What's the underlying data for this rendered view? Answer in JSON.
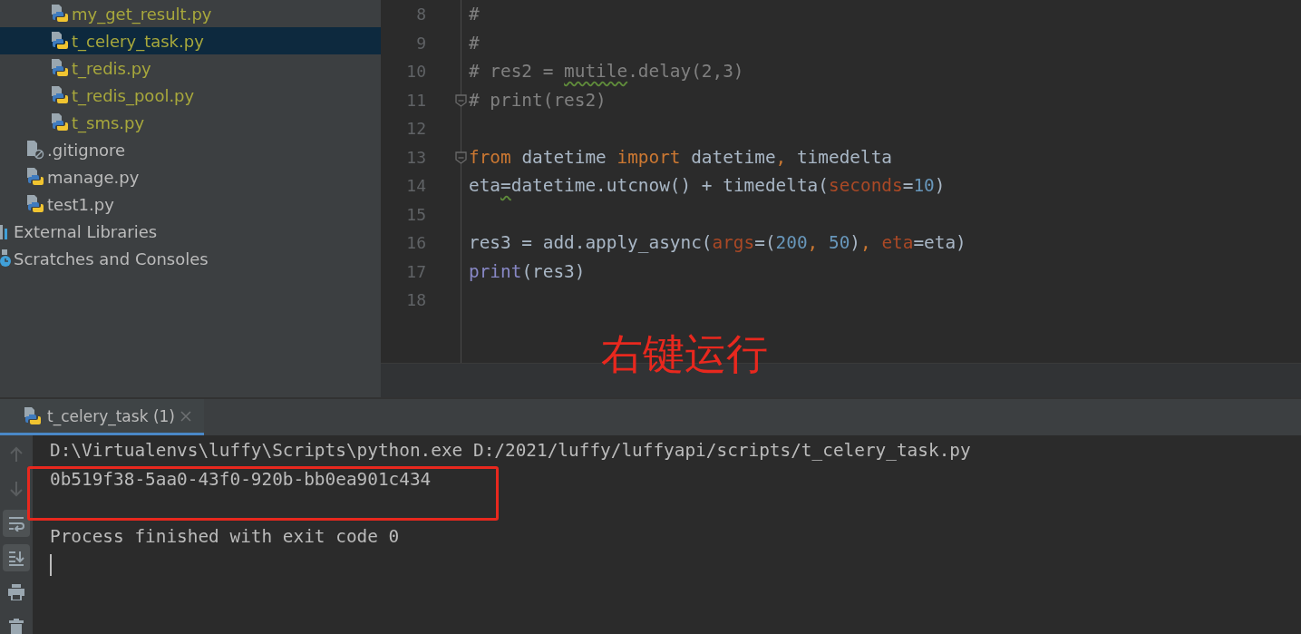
{
  "project_tree": [
    {
      "children": [
        {
          "children": [
            {
              "label": "my_get_result.py",
              "kind": "python",
              "color": "#a8a83c",
              "selected": false
            },
            {
              "label": "t_celery_task.py",
              "kind": "python",
              "color": "#a8a83c",
              "selected": true
            },
            {
              "label": "t_redis.py",
              "kind": "python",
              "color": "#a8a83c",
              "selected": false
            },
            {
              "label": "t_redis_pool.py",
              "kind": "python",
              "color": "#a8a83c",
              "selected": false
            },
            {
              "label": "t_sms.py",
              "kind": "python",
              "color": "#a8a83c",
              "selected": false
            }
          ]
        },
        {
          "label": ".gitignore",
          "kind": "ignored",
          "color": "#bbbbbb",
          "selected": false
        },
        {
          "label": "manage.py",
          "kind": "python",
          "color": "#bbbbbb",
          "selected": false
        },
        {
          "label": "test1.py",
          "kind": "python",
          "color": "#bbbbbb",
          "selected": false
        }
      ]
    },
    {
      "label": "External Libraries",
      "kind": "library",
      "color": "#bbbbbb",
      "selected": false
    },
    {
      "label": "Scratches and Consoles",
      "kind": "scratch",
      "color": "#bbbbbb",
      "selected": false
    }
  ],
  "editor": {
    "lines": [
      {
        "number": "8",
        "fold": false,
        "tokens": [
          {
            "text": "#",
            "kind": "comment"
          }
        ]
      },
      {
        "number": "9",
        "fold": false,
        "tokens": [
          {
            "text": "#",
            "kind": "comment"
          }
        ]
      },
      {
        "number": "10",
        "fold": false,
        "tokens": [
          {
            "text": "# res2 = ",
            "kind": "comment"
          },
          {
            "text": "mutile",
            "kind": "comment_typo"
          },
          {
            "text": ".delay(2,3)",
            "kind": "comment"
          }
        ]
      },
      {
        "number": "11",
        "fold": true,
        "tokens": [
          {
            "text": "# print(res2)",
            "kind": "comment"
          }
        ]
      },
      {
        "number": "12",
        "fold": false
      },
      {
        "number": "13",
        "fold": true,
        "tokens": [
          {
            "text": "from",
            "kind": "keyword"
          },
          {
            "text": " datetime ",
            "kind": "plain"
          },
          {
            "text": "import",
            "kind": "keyword"
          },
          {
            "text": " datetime",
            "kind": "plain"
          },
          {
            "text": ",",
            "kind": "keyword"
          },
          {
            "text": " timedelta",
            "kind": "plain"
          }
        ]
      },
      {
        "number": "14",
        "fold": false,
        "tokens": [
          {
            "text": "eta",
            "kind": "plain"
          },
          {
            "text": "=",
            "kind": "plain_typo"
          },
          {
            "text": "datetime.utcnow() + timedelta(",
            "kind": "plain"
          },
          {
            "text": "seconds",
            "kind": "param"
          },
          {
            "text": "=",
            "kind": "plain"
          },
          {
            "text": "10",
            "kind": "number"
          },
          {
            "text": ")",
            "kind": "plain"
          }
        ]
      },
      {
        "number": "15",
        "fold": false
      },
      {
        "number": "16",
        "fold": false,
        "tokens": [
          {
            "text": "res3 = add.apply_async(",
            "kind": "plain"
          },
          {
            "text": "args",
            "kind": "param"
          },
          {
            "text": "=(",
            "kind": "plain"
          },
          {
            "text": "200",
            "kind": "number"
          },
          {
            "text": ", ",
            "kind": "keyword"
          },
          {
            "text": "50",
            "kind": "number"
          },
          {
            "text": ")",
            "kind": "plain"
          },
          {
            "text": ", ",
            "kind": "keyword"
          },
          {
            "text": "eta",
            "kind": "param"
          },
          {
            "text": "=eta)",
            "kind": "plain"
          }
        ]
      },
      {
        "number": "17",
        "fold": false,
        "tokens": [
          {
            "text": "print",
            "kind": "builtin"
          },
          {
            "text": "(res3)",
            "kind": "plain"
          }
        ]
      },
      {
        "number": "18",
        "fold": false
      }
    ],
    "annotation": "右键运行"
  },
  "run_panel": {
    "tabs": [
      {
        "label": "t_celery_task (1)",
        "selected": true
      }
    ],
    "tools": [
      {
        "kind": "up",
        "on": false
      },
      {
        "kind": "down",
        "on": false
      },
      {
        "kind": "wrap",
        "on": true
      },
      {
        "kind": "scroll_end",
        "on": true
      },
      {
        "kind": "print",
        "on": false
      },
      {
        "kind": "trash",
        "on": false
      }
    ],
    "output": [
      "D:\\Virtualenvs\\luffy\\Scripts\\python.exe D:/2021/luffy/luffyapi/scripts/t_celery_task.py",
      "0b519f38-5aa0-43f0-920b-bb0ea901c434"
    ],
    "exit_message": "Process finished with exit code 0"
  }
}
